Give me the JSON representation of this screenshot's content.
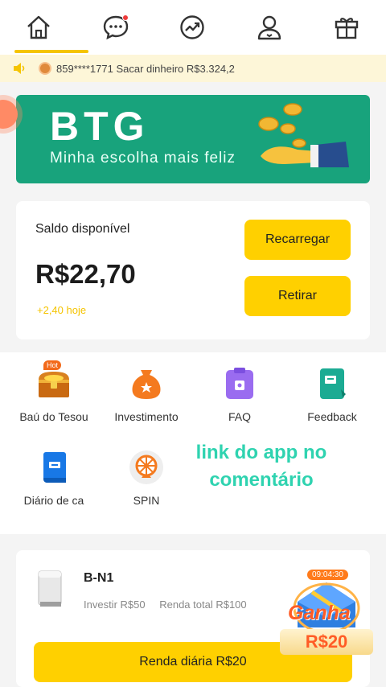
{
  "nav": {
    "items": [
      {
        "icon": "home-icon",
        "label": ""
      },
      {
        "icon": "chat-icon",
        "label": ""
      },
      {
        "icon": "trend-icon",
        "label": ""
      },
      {
        "icon": "user-icon",
        "label": ""
      },
      {
        "icon": "gift-icon",
        "label": ""
      }
    ],
    "active_index": 0,
    "accent": "#f5c400"
  },
  "marquee": {
    "text": "859****1771 Sacar dinheiro R$3.324,2"
  },
  "banner": {
    "brand": "BTG",
    "slogan": "Minha escolha mais feliz",
    "color": "#18a37c"
  },
  "balance": {
    "label": "Saldo disponível",
    "amount": "R$22,70",
    "today": "+2,40 hoje",
    "recharge_label": "Recarregar",
    "withdraw_label": "Retirar"
  },
  "menu": {
    "items": [
      {
        "label": "Baú do Tesou",
        "badge": "Hot",
        "icon": "treasure-chest-icon"
      },
      {
        "label": "Investimento",
        "icon": "money-bag-icon"
      },
      {
        "label": "FAQ",
        "icon": "faq-icon"
      },
      {
        "label": "Feedback",
        "icon": "feedback-icon"
      },
      {
        "label": "Diário de ca",
        "icon": "book-icon"
      },
      {
        "label": "SPIN",
        "icon": "spin-wheel-icon"
      }
    ]
  },
  "promo": {
    "line1": "link do app no",
    "line2": "comentário"
  },
  "product": {
    "name": "B-N1",
    "invest": "Investir R$50",
    "total": "Renda total R$100",
    "daily_label": "Renda diária R$20"
  },
  "ganha": {
    "timer": "09:04:30",
    "label": "Ganha",
    "amount": "R$20"
  }
}
